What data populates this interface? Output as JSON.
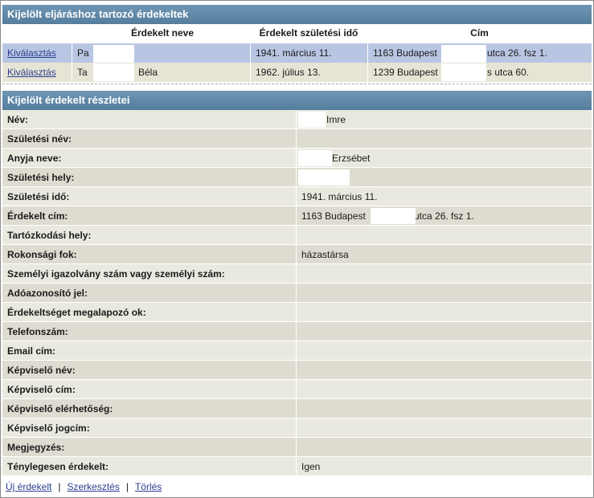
{
  "list_section": {
    "title": "Kijelölt eljáráshoz tartozó érdekeltek",
    "columns": [
      "",
      "Érdekelt neve",
      "Érdekelt születési idő",
      "Cím"
    ],
    "rows": [
      {
        "action": "Kiválasztás",
        "name": "Pa",
        "birth": "1941. március 11.",
        "address": "1163 Budapest",
        "address_tail": "utca 26. fsz 1."
      },
      {
        "action": "Kiválasztás",
        "name": "Ta",
        "name_tail": "Béla",
        "birth": "1962. július 13.",
        "address": "1239 Budapest",
        "address_tail": "s utca 60."
      }
    ]
  },
  "detail_section": {
    "title": "Kijelölt érdekelt részletei",
    "fields": [
      {
        "label": "Név:",
        "value": "Imre"
      },
      {
        "label": "Születési név:",
        "value": ""
      },
      {
        "label": "Anyja neve:",
        "value": "Erzsébet"
      },
      {
        "label": "Születési hely:",
        "value": ""
      },
      {
        "label": "Születési idő:",
        "value": "1941. március 11."
      },
      {
        "label": "Érdekelt cím:",
        "value": "1163 Budapest",
        "value_tail": "utca 26. fsz 1."
      },
      {
        "label": "Tartózkodási hely:",
        "value": ""
      },
      {
        "label": "Rokonsági fok:",
        "value": "házastársa"
      },
      {
        "label": "Személyi igazolvány szám vagy személyi szám:",
        "value": ""
      },
      {
        "label": "Adóazonosító jel:",
        "value": ""
      },
      {
        "label": "Érdekeltséget megalapozó ok:",
        "value": ""
      },
      {
        "label": "Telefonszám:",
        "value": ""
      },
      {
        "label": "Email cím:",
        "value": ""
      },
      {
        "label": "Képviselő név:",
        "value": ""
      },
      {
        "label": "Képviselő cím:",
        "value": ""
      },
      {
        "label": "Képviselő elérhetőség:",
        "value": ""
      },
      {
        "label": "Képviselő jogcím:",
        "value": ""
      },
      {
        "label": "Megjegyzés:",
        "value": ""
      },
      {
        "label": "Ténylegesen érdekelt:",
        "value": "Igen"
      }
    ]
  },
  "footer": {
    "new_label": "Új érdekelt",
    "separator": "|",
    "edit_label": "Szerkesztés",
    "delete_label": "Törlés"
  }
}
